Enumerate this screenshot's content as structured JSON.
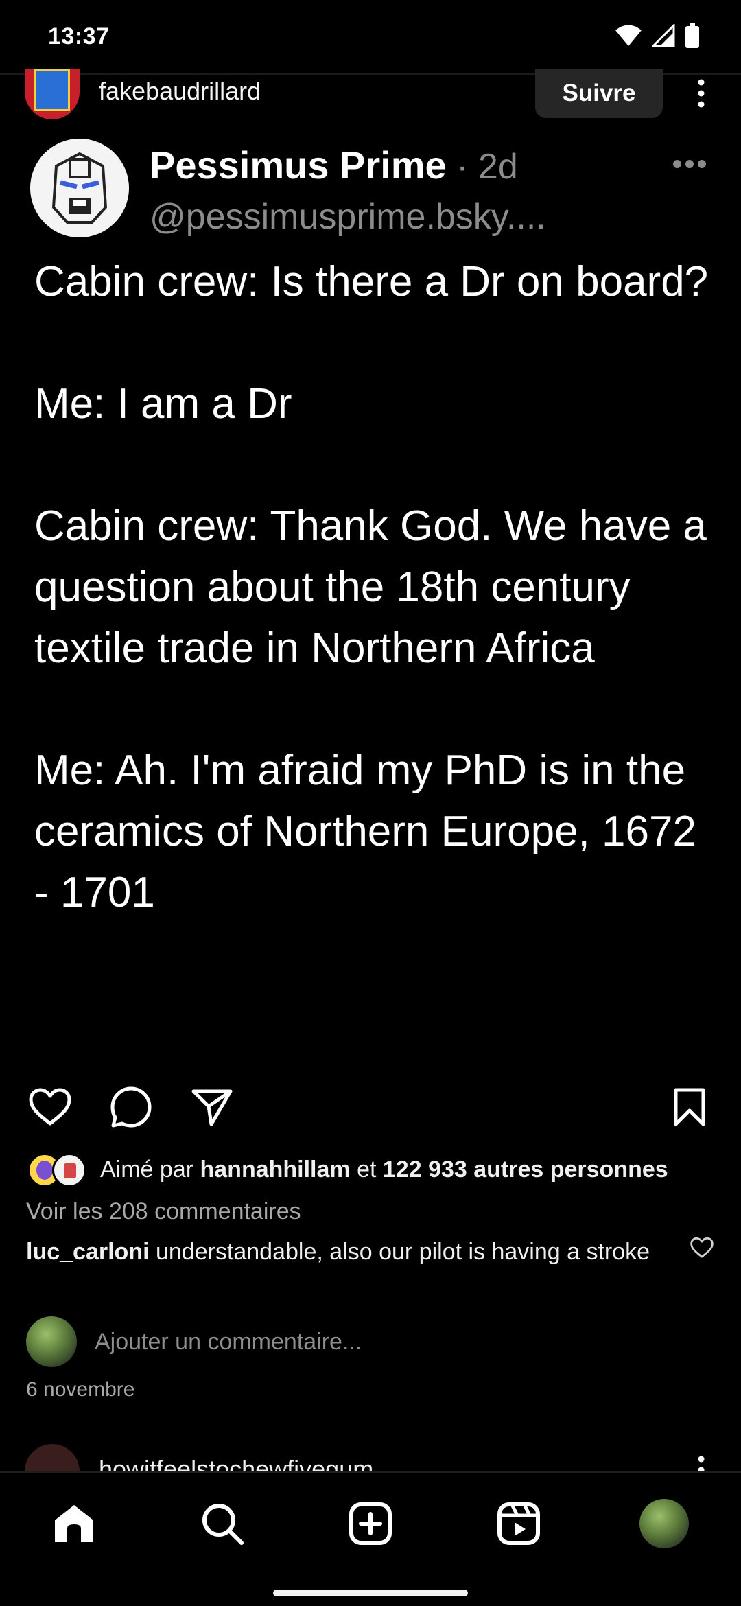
{
  "status_bar": {
    "time": "13:37",
    "icons": [
      "wifi-icon",
      "signal-icon",
      "battery-icon"
    ]
  },
  "post": {
    "username": "fakebaudrillard",
    "follow_label": "Suivre",
    "author": {
      "name": "Pessimus Prime",
      "time": " · 2d",
      "handle": "@pessimusprime.bsky...."
    },
    "text": "Cabin crew: Is there a Dr on board?\n\nMe: I am a Dr\n\nCabin crew: Thank God. We have a question about the 18th century textile trade in Northern Africa\n\nMe: Ah. I'm afraid my PhD is in the ceramics of Northern Europe, 1672 - 1701",
    "likes": {
      "prefix": "Aimé par ",
      "liker": "hannahhillam",
      "middle": " et ",
      "count_text": "122 933 autres personnes"
    },
    "view_comments": "Voir les 208 commentaires",
    "comment": {
      "user": "luc_carloni",
      "text": " understandable, also our pilot is having a stroke"
    },
    "add_comment_placeholder": "Ajouter un commentaire...",
    "date": "6 novembre"
  },
  "next_post": {
    "username": "howitfeelstochewfivegum"
  },
  "bottom_nav": {
    "items": [
      "home-icon",
      "search-icon",
      "create-icon",
      "reels-icon",
      "profile-avatar"
    ]
  },
  "colors": {
    "background": "#000000",
    "text": "#ffffff",
    "muted": "#a8a8a8",
    "button_bg": "#262626"
  }
}
